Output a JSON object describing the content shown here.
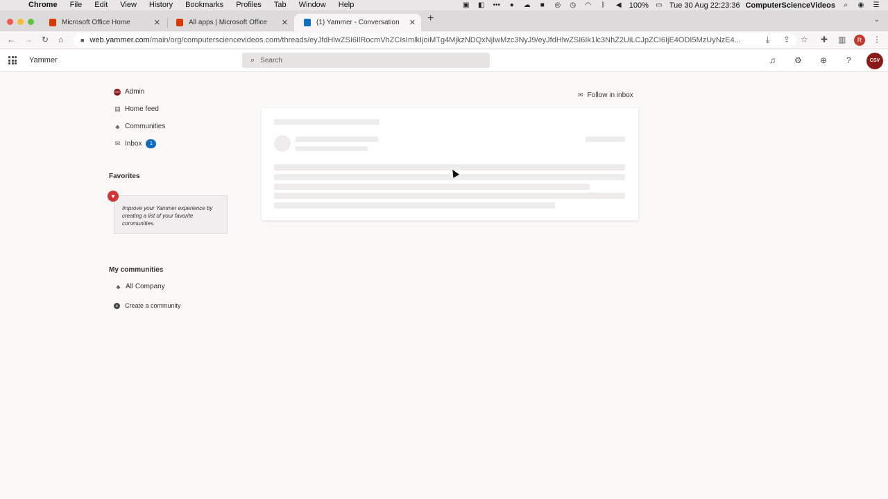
{
  "menubar": {
    "app": "Chrome",
    "menus": [
      "File",
      "Edit",
      "View",
      "History",
      "Bookmarks",
      "Profiles",
      "Tab",
      "Window",
      "Help"
    ],
    "battery": "100%",
    "datetime": "Tue 30 Aug  22:23:36",
    "user": "ComputerScienceVideos"
  },
  "tabs": [
    {
      "title": "Microsoft Office Home"
    },
    {
      "title": "All apps | Microsoft Office"
    },
    {
      "title": "(1) Yammer - Conversation"
    }
  ],
  "address": {
    "host": "web.yammer.com",
    "path": "/main/org/computersciencevideos.com/threads/eyJfdHlwZSI6IlRocmVhZCIsImlkIjoiMTg4MjkzNDQxNjIwMzc3NyJ9/eyJfdHlwZSI6Ik1lc3NhZ2UiLCJpZCI6IjE4ODI5MzUyNzE4..."
  },
  "header": {
    "brand": "Yammer",
    "search_placeholder": "Search",
    "logo_text": "CSV",
    "profile_initial": "R"
  },
  "nav": {
    "admin": "Admin",
    "home": "Home feed",
    "communities": "Communities",
    "inbox": "Inbox",
    "inbox_count": "1"
  },
  "favorites": {
    "title": "Favorites",
    "hint": "Improve your Yammer experience by creating a list of your favorite communities."
  },
  "my_communities": {
    "title": "My communities",
    "items": [
      "All Company"
    ],
    "create": "Create a community"
  },
  "thread": {
    "follow": "Follow in inbox"
  }
}
